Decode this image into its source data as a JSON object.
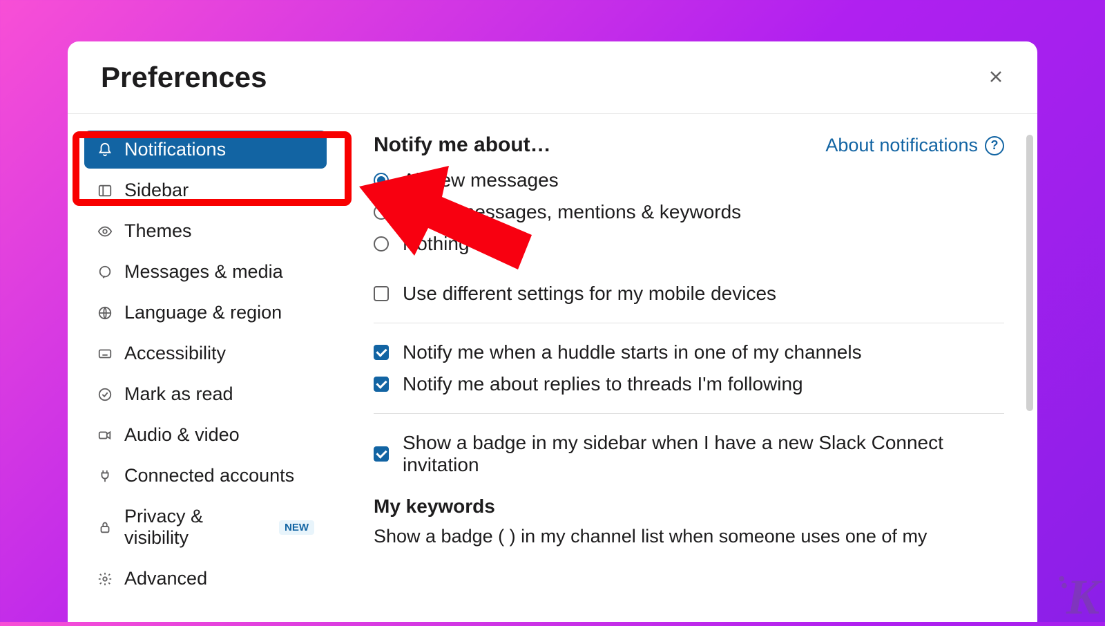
{
  "modal": {
    "title": "Preferences"
  },
  "sidebar": {
    "items": [
      {
        "label": "Notifications",
        "active": true,
        "icon": "bell"
      },
      {
        "label": "Sidebar",
        "active": false,
        "icon": "sidebar"
      },
      {
        "label": "Themes",
        "active": false,
        "icon": "eye"
      },
      {
        "label": "Messages & media",
        "active": false,
        "icon": "chat"
      },
      {
        "label": "Language & region",
        "active": false,
        "icon": "globe"
      },
      {
        "label": "Accessibility",
        "active": false,
        "icon": "keyboard"
      },
      {
        "label": "Mark as read",
        "active": false,
        "icon": "check-circle"
      },
      {
        "label": "Audio & video",
        "active": false,
        "icon": "video"
      },
      {
        "label": "Connected accounts",
        "active": false,
        "icon": "plug"
      },
      {
        "label": "Privacy & visibility",
        "active": false,
        "icon": "lock",
        "badge": "NEW"
      },
      {
        "label": "Advanced",
        "active": false,
        "icon": "gear"
      }
    ]
  },
  "content": {
    "notify_heading": "Notify me about…",
    "about_link": "About notifications",
    "radios": [
      {
        "label": "All new messages",
        "checked": true
      },
      {
        "label": "Direct messages, mentions & keywords",
        "checked": false
      },
      {
        "label": "Nothing",
        "checked": false
      }
    ],
    "mobile_checkbox": {
      "label": "Use different settings for my mobile devices",
      "checked": false
    },
    "checks_group": [
      {
        "label": "Notify me when a huddle starts in one of my channels",
        "checked": true
      },
      {
        "label": "Notify me about replies to threads I'm following",
        "checked": true
      }
    ],
    "connect_check": {
      "label": "Show a badge in my sidebar when I have a new Slack Connect invitation",
      "checked": true
    },
    "keywords_heading": "My keywords",
    "truncated": "Show a badge (    ) in my channel list when someone uses one of my"
  },
  "watermark": "K"
}
